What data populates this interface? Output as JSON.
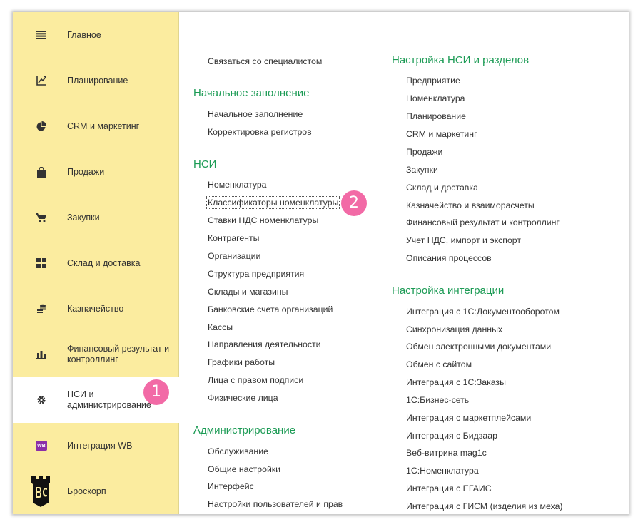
{
  "sidebar": {
    "items": [
      {
        "label": "Главное",
        "icon": "menu-lines-icon"
      },
      {
        "label": "Планирование",
        "icon": "planning-chart-icon"
      },
      {
        "label": "CRM и маркетинг",
        "icon": "pie-chart-icon"
      },
      {
        "label": "Продажи",
        "icon": "shopping-bag-icon"
      },
      {
        "label": "Закупки",
        "icon": "cart-icon"
      },
      {
        "label": "Склад и доставка",
        "icon": "warehouse-grid-icon"
      },
      {
        "label": "Казначейство",
        "icon": "coins-icon"
      },
      {
        "label": "Финансовый результат и контроллинг",
        "icon": "bar-chart-icon"
      },
      {
        "label": "НСИ и администрирование",
        "icon": "gear-icon",
        "active": true
      },
      {
        "label": "Интеграция WB",
        "icon": "wb-logo-icon",
        "icon_text": "WB"
      },
      {
        "label": "Броскорп",
        "icon": "broscorp-logo-icon"
      }
    ]
  },
  "badges": {
    "step1": "1",
    "step2": "2"
  },
  "col1": {
    "top_link": "Связаться со специалистом",
    "sections": [
      {
        "title": "Начальное заполнение",
        "items": [
          "Начальное заполнение",
          "Корректировка регистров"
        ]
      },
      {
        "title": "НСИ",
        "items": [
          "Номенклатура",
          "Классификаторы номенклатуры",
          "Ставки НДС номенклатуры",
          "Контрагенты",
          "Организации",
          "Структура предприятия",
          "Склады и магазины",
          "Банковские счета организаций",
          "Кассы",
          "Направления деятельности",
          "Графики работы",
          "Лица с правом подписи",
          "Физические лица"
        ]
      },
      {
        "title": "Администрирование",
        "items": [
          "Обслуживание",
          "Общие настройки",
          "Интерфейс",
          "Настройки пользователей и прав"
        ]
      }
    ]
  },
  "col2": {
    "sections": [
      {
        "title": "Настройка НСИ и разделов",
        "items": [
          "Предприятие",
          "Номенклатура",
          "Планирование",
          "CRM и маркетинг",
          "Продажи",
          "Закупки",
          "Склад и доставка",
          "Казначейство и взаиморасчеты",
          "Финансовый результат и контроллинг",
          "Учет НДС, импорт и экспорт",
          "Описания процессов"
        ]
      },
      {
        "title": "Настройка интеграции",
        "items": [
          "Интеграция с 1С:Документооборотом",
          "Синхронизация данных",
          "Обмен электронными документами",
          "Обмен с сайтом",
          "Интеграция с 1С:Заказы",
          "1С:Бизнес-сеть",
          "Интеграция с маркетплейсами",
          "Интеграция с Бидзаар",
          "Веб-витрина mag1c",
          "1С:Номенклатура",
          "Интеграция с ЕГАИС",
          "Интеграция с ГИСМ (изделия из меха)"
        ]
      }
    ]
  },
  "colors": {
    "sidebar_bg": "#fbec9f",
    "section_header": "#1c9b55",
    "badge": "#f26aa6",
    "wb_icon": "#8b2fa8"
  }
}
